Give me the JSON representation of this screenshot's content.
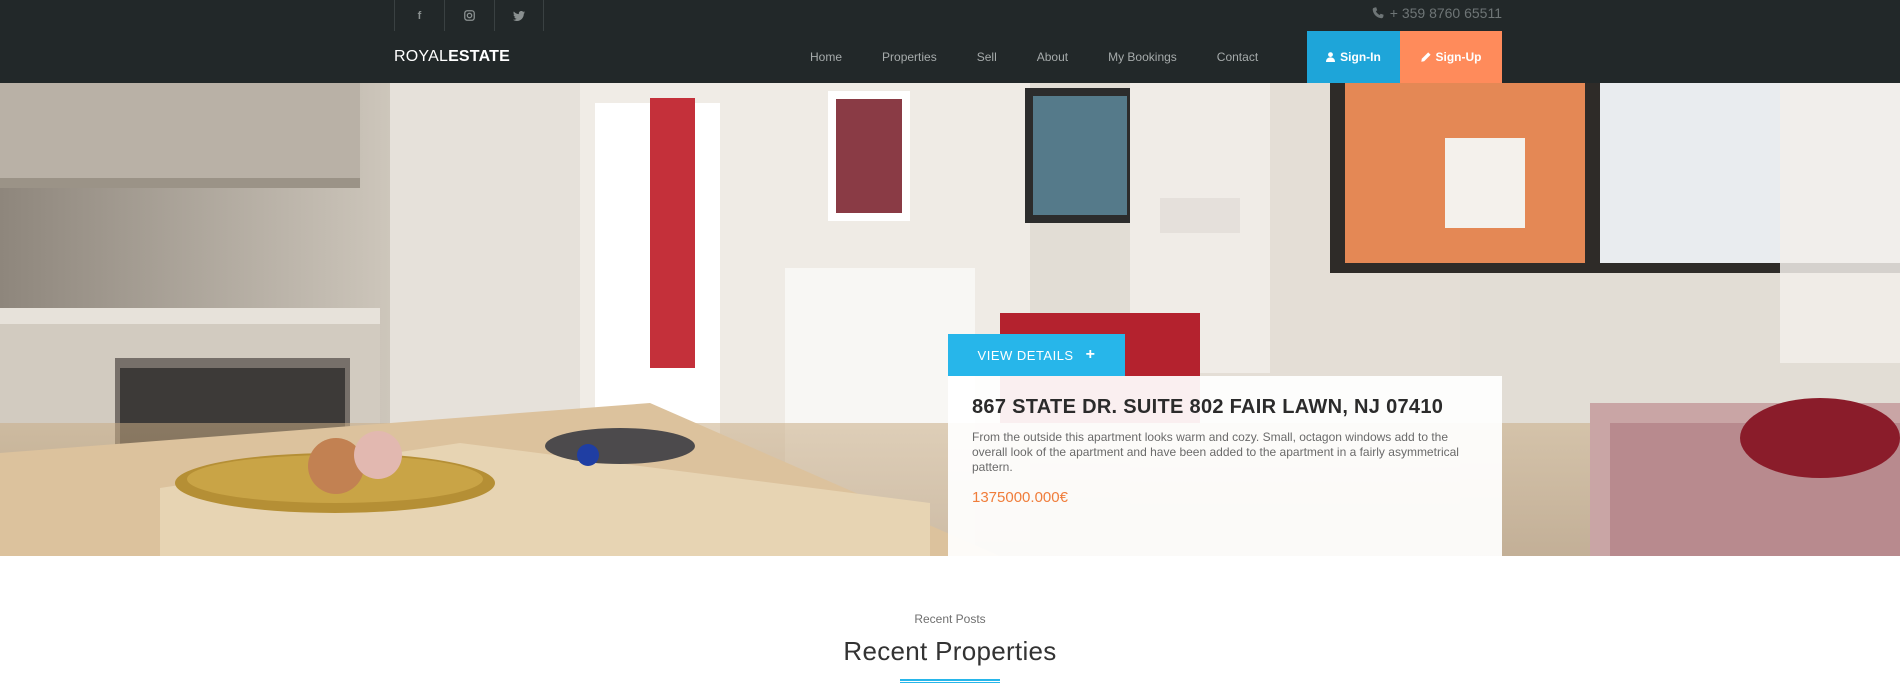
{
  "topbar": {
    "social": [
      {
        "icon": "facebook-icon",
        "label": "f"
      },
      {
        "icon": "instagram-icon",
        "label": ""
      },
      {
        "icon": "twitter-icon",
        "label": ""
      }
    ],
    "phone": "+ 359 8760 65511"
  },
  "header": {
    "logo_light": "ROYAL",
    "logo_bold": "ESTATE",
    "nav": [
      "Home",
      "Properties",
      "Sell",
      "About",
      "My Bookings",
      "Contact"
    ],
    "signin_label": "Sign-In",
    "signup_label": "Sign-Up"
  },
  "hero": {
    "button_label": "VIEW DETAILS",
    "title": "867 STATE DR. SUITE 802 FAIR LAWN, NJ 07410",
    "description": "From the outside this apartment looks warm and cozy. Small, octagon windows add to the overall look of the apartment and have been added to the apartment in a fairly asymmetrical pattern.",
    "price": "1375000.000€"
  },
  "recent": {
    "eyebrow": "Recent Posts",
    "title": "Recent Properties"
  },
  "colors": {
    "dark_bar": "#222829",
    "accent_blue": "#1ea5d9",
    "accent_orange": "#ff8b5b",
    "price_orange": "#f07d3b"
  }
}
